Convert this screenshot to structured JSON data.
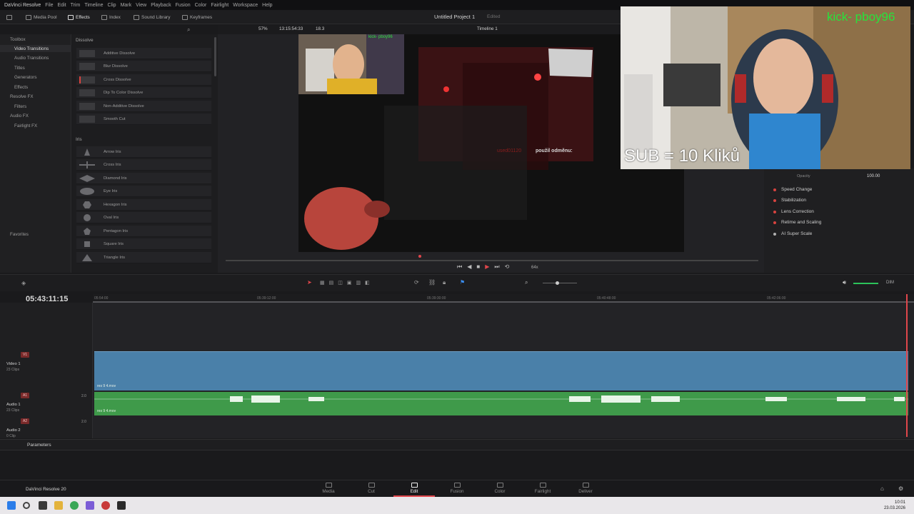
{
  "menubar": {
    "app_name": "DaVinci Resolve",
    "items": [
      "File",
      "Edit",
      "Trim",
      "Timeline",
      "Clip",
      "Mark",
      "View",
      "Playback",
      "Fusion",
      "Color",
      "Fairlight",
      "Workspace",
      "Help"
    ]
  },
  "toolbar": {
    "media_pool": "Media Pool",
    "effects": "Effects",
    "index": "Index",
    "sound_library": "Sound Library",
    "keyframes": "Keyframes",
    "project_title": "Untitled Project 1",
    "project_status": "Edited",
    "zoom": "57%",
    "viewer_timecode": "13:15:54:33",
    "fps_value": "18.3",
    "timeline_name": "Timeline 1"
  },
  "toolbox": {
    "header": "Toolbox",
    "items": [
      {
        "label": "Video Transitions",
        "selected": true
      },
      {
        "label": "Audio Transitions"
      },
      {
        "label": "Titles"
      },
      {
        "label": "Generators"
      },
      {
        "label": "Effects"
      },
      {
        "label": "Resolve FX"
      },
      {
        "label": "Filters"
      },
      {
        "label": "Audio FX"
      },
      {
        "label": "Fairlight FX"
      }
    ],
    "favorites": "Favorites"
  },
  "effects": {
    "dissolve_header": "Dissolve",
    "dissolve": [
      "Additive Dissolve",
      "Blur Dissolve",
      "Cross Dissolve",
      "Dip To Color Dissolve",
      "Non-Additive Dissolve",
      "Smooth Cut"
    ],
    "iris_header": "Iris",
    "iris": [
      "Arrow Iris",
      "Cross Iris",
      "Diamond Iris",
      "Eye Iris",
      "Hexagon Iris",
      "Oval Iris",
      "Pentagon Iris",
      "Square Iris",
      "Triangle Iris"
    ]
  },
  "viewer": {
    "chat_user": "used01120",
    "chat_text": "použil odměnu:",
    "small_kick": "kick- pboy96",
    "speed": "64x"
  },
  "inspector": {
    "opacity_label": "Opacity",
    "opacity_value": "100.00",
    "items": [
      "Speed Change",
      "Stabilization",
      "Lens Correction",
      "Retime and Scaling",
      "AI Super Scale"
    ]
  },
  "overlay": {
    "sub_text": "SUB = 10 Kliků",
    "kick_text": "kick- pboy96"
  },
  "timeline": {
    "timecode": "05:43:11:15",
    "ruler_labels": [
      "05:54:00",
      "05:39:12:00",
      "05:39:30:00",
      "05:40:48:00",
      "05:42:06:00"
    ],
    "volume_label": "DIM",
    "tracks": {
      "v1_tag": "V1",
      "v1_name": "Video 1",
      "v1_clips": "23 Clips",
      "a1_tag": "A1",
      "a1_name": "Audio 1",
      "a1_clips": "23 Clips",
      "a1_level": "2.0",
      "a2_tag": "A2",
      "a2_name": "Audio 2",
      "a2_clips": "0 Clip",
      "a2_level": "2.0"
    },
    "clip_name": "res 9 4.mov",
    "params_label": "Parameters"
  },
  "pages": {
    "app_label": "DaVinci Resolve 20",
    "tabs": [
      "Media",
      "Cut",
      "Edit",
      "Fusion",
      "Color",
      "Fairlight",
      "Deliver"
    ],
    "active": "Edit"
  },
  "taskbar": {
    "time": "10:01",
    "date": "23.03.2026"
  }
}
